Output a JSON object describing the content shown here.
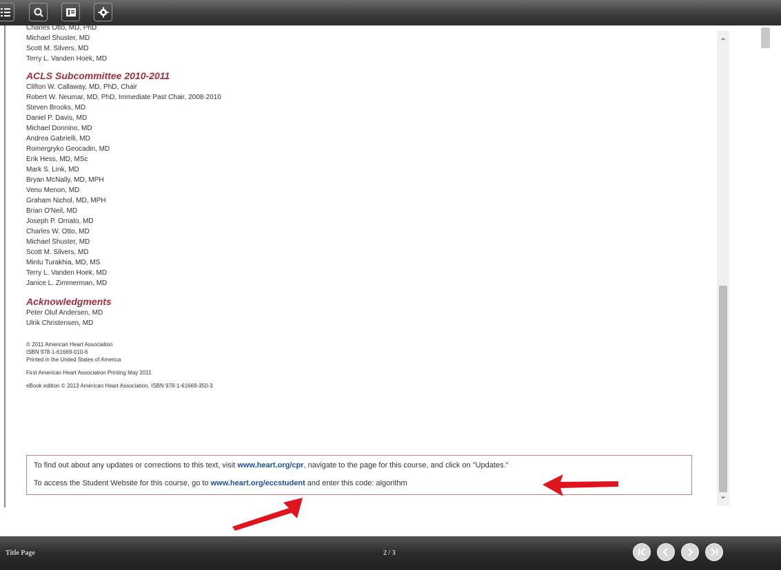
{
  "toolbar": {
    "buttons": [
      "toc-icon",
      "search-icon",
      "book-icon",
      "settings-icon"
    ]
  },
  "page": {
    "top_names": [
      "Charles Otto, MD, PhD",
      "Michael Shuster, MD",
      "Scott M. Silvers, MD",
      "Terry L. Vanden Hoek, MD"
    ],
    "acls_title": "ACLS Subcommittee 2010-2011",
    "acls_names": [
      "Clifton W. Callaway, MD, PhD, Chair",
      "Robert W. Neumar, MD, PhD, Immediate Past Chair, 2008-2010",
      "Steven Brooks, MD",
      "Daniel P. Davis, MD",
      "Michael Donnino, MD",
      "Andrea Gabrielli, MD",
      "Romergryko Geocadin, MD",
      "Erik Hess, MD, MSc",
      "Mark S. Link, MD",
      "Bryan McNally, MD, MPH",
      "Venu Menon, MD",
      "Graham Nichol, MD, MPH",
      "Brian O'Neil, MD",
      "Joseph P. Ornato, MD",
      "Charles W. Otto, MD",
      "Michael Shuster, MD",
      "Scott M. Silvers, MD",
      "Mintu Turakhia, MD, MS",
      "Terry L. Vanden Hoek, MD",
      "Janice L. Zimmerman, MD"
    ],
    "ack_title": "Acknowledgments",
    "ack_names": [
      "Peter Oluf Andersen, MD",
      "Ulrik Christensen, MD"
    ],
    "legal": [
      "© 2011 American Heart Association",
      "ISBN 978-1-61669-010-6",
      "Printed in the United States of America"
    ],
    "printing": "First American Heart Association Printing May 2011",
    "ebook": "eBook edition © 2013 American Heart Association. ISBN 978-1-61669-350-3",
    "notice": {
      "line1_pre": "To find out about any updates or corrections to this text, visit ",
      "line1_link": "www.heart.org/cpr",
      "line1_post": ", navigate to the page for this course, and click on \"Updates.\"",
      "line2_pre": "To access the Student Website for this course, go to ",
      "line2_link": "www.heart.org/eccstudent",
      "line2_post": " and enter this code: algorithm"
    }
  },
  "bottombar": {
    "section_label": "Title Page",
    "page_indicator": "2 / 3"
  },
  "colors": {
    "section_title": "#a03040",
    "link": "#1f4fa0",
    "arrow": "#e0141e"
  }
}
